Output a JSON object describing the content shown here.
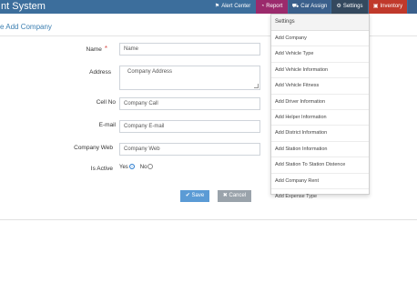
{
  "header": {
    "app_title": "nt System",
    "nav": [
      {
        "label": "Alert Center",
        "icon": "bell-icon",
        "glyph": "🔔"
      },
      {
        "label": "Report",
        "icon": "pie-chart-icon",
        "glyph": "◔"
      },
      {
        "label": "Car Assign",
        "icon": "car-icon",
        "glyph": "🚗"
      },
      {
        "label": "Settings",
        "icon": "gears-icon",
        "glyph": "⚙"
      },
      {
        "label": "Inventory",
        "icon": "inventory-icon",
        "glyph": "▣"
      }
    ],
    "colors": {
      "navbar": "#3c6e9c",
      "report": "#9b2a6c",
      "settings": "#34495e",
      "inventory": "#c0392b",
      "active": "#3a5f8b"
    }
  },
  "page": {
    "title": "e Add Company"
  },
  "form": {
    "name_label": "Name",
    "name_placeholder": "Name",
    "address_label": "Address",
    "address_placeholder": "Company Address",
    "cell_label": "Cell No",
    "cell_placeholder": "Company Call",
    "email_label": "E-mail",
    "email_placeholder": "Company E-mail",
    "web_label": "Company Web",
    "web_placeholder": "Company Web",
    "active_label": "Is Active",
    "yes_label": "Yes",
    "no_label": "No",
    "save_label": "Save",
    "cancel_label": "Cancel"
  },
  "settings_menu": {
    "header": "Settings",
    "items": [
      "Add Company",
      "Add Vehicle Type",
      "Add Vehicle Information",
      "Add Vehicle Fitness",
      "Add Driver Information",
      "Add Helper Information",
      "Add District Information",
      "Add Station Information",
      "Add Station To Station Distence",
      "Add Company Rent",
      "Add Expense Type"
    ]
  }
}
